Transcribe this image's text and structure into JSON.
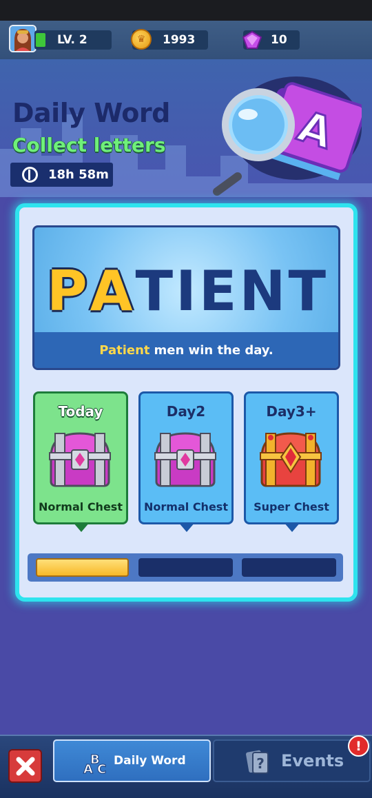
{
  "topbar": {
    "level": "LV. 2",
    "coins": "1993",
    "gems": "10"
  },
  "header": {
    "title": "Daily Word",
    "subtitle": "Collect letters",
    "timer": "18h 58m"
  },
  "word": {
    "letters": [
      {
        "char": "P",
        "found": true
      },
      {
        "char": "A",
        "found": true
      },
      {
        "char": "T",
        "found": false
      },
      {
        "char": "I",
        "found": false
      },
      {
        "char": "E",
        "found": false
      },
      {
        "char": "N",
        "found": false
      },
      {
        "char": "T",
        "found": false
      }
    ],
    "proverb_highlight": "Patient",
    "proverb_rest": "men win the day."
  },
  "rewards": [
    {
      "day": "Today",
      "chest": "Normal Chest"
    },
    {
      "day": "Day2",
      "chest": "Normal Chest"
    },
    {
      "day": "Day3+",
      "chest": "Super Chest"
    }
  ],
  "progress": {
    "segments_total": 3,
    "segments_filled": 1
  },
  "bottom_nav": {
    "daily_word_label": "Daily Word",
    "events_label": "Events",
    "events_alert": "!"
  },
  "colors": {
    "accent_yellow": "#ffc426",
    "panel_border": "#2ee3ee",
    "subtitle_green": "#6ff07a",
    "close_red": "#d73b3b"
  },
  "icons": [
    "avatar",
    "coin-icon",
    "gem-icon",
    "timer-icon",
    "magnifier-book-icon",
    "normal-chest-icon",
    "super-chest-icon",
    "close-icon",
    "abc-icon",
    "events-card-icon",
    "alert-icon"
  ]
}
